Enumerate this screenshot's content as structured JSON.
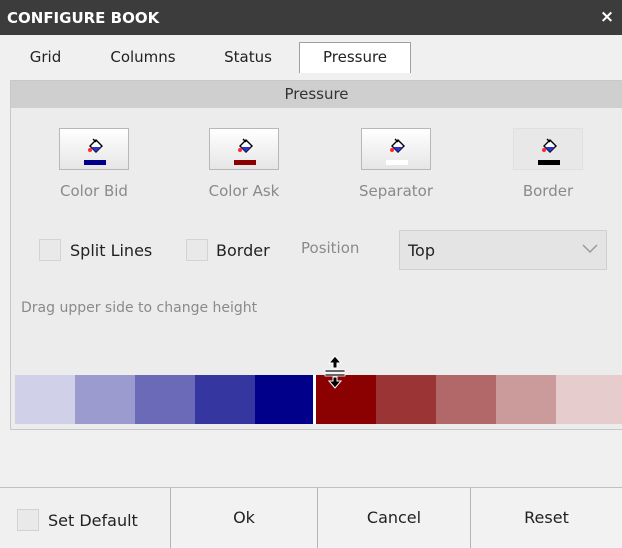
{
  "window": {
    "title": "CONFIGURE BOOK",
    "close_label": "×"
  },
  "tabs": [
    {
      "label": "Grid",
      "active": false
    },
    {
      "label": "Columns",
      "active": false
    },
    {
      "label": "Status",
      "active": false
    },
    {
      "label": "Pressure",
      "active": true
    }
  ],
  "panel": {
    "header": "Pressure",
    "color_buttons": [
      {
        "label": "Color Bid",
        "icon": "paint-bucket-icon",
        "swatch": "#00008b"
      },
      {
        "label": "Color Ask",
        "icon": "paint-bucket-icon",
        "swatch": "#8b0000"
      },
      {
        "label": "Separator",
        "icon": "paint-bucket-icon",
        "swatch": "#ffffff"
      },
      {
        "label": "Border",
        "icon": "paint-bucket-icon",
        "swatch": "#000000"
      }
    ],
    "split_lines_label": "Split Lines",
    "split_lines_checked": false,
    "border_label": "Border",
    "border_checked": false,
    "position_label": "Position",
    "position_value": "Top",
    "hint": "Drag upper side to change height",
    "bid_shades": [
      "#d0d0e8",
      "#9b9bd0",
      "#6a6ab8",
      "#3636a0",
      "#00008b"
    ],
    "ask_shades": [
      "#8b0000",
      "#9b3434",
      "#b26868",
      "#cb9a9a",
      "#e6cccc"
    ]
  },
  "footer": {
    "set_default_label": "Set Default",
    "set_default_checked": false,
    "ok_label": "Ok",
    "cancel_label": "Cancel",
    "reset_label": "Reset"
  }
}
